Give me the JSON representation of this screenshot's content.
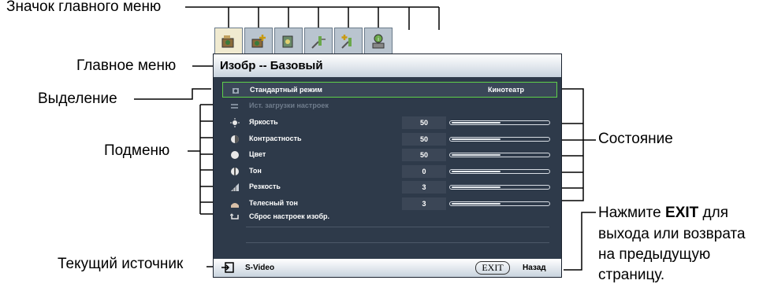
{
  "callouts": {
    "main_menu_icon": "Значок главного меню",
    "main_menu": "Главное меню",
    "highlight": "Выделение",
    "submenu": "Подменю",
    "status": "Состояние",
    "current_source": "Текущий источник",
    "exit_note_pre": "Нажмите ",
    "exit_note_key": "EXIT",
    "exit_note_post": " для",
    "exit_note_line2": "выхода или возврата",
    "exit_note_line3": "на предыдущую",
    "exit_note_line4": "страницу."
  },
  "tabs": [
    {
      "icon": "picture-icon",
      "active": true
    },
    {
      "icon": "picture-advanced-icon",
      "active": false
    },
    {
      "icon": "display-icon",
      "active": false
    },
    {
      "icon": "settings-basic-icon",
      "active": false
    },
    {
      "icon": "settings-advanced-icon",
      "active": false
    },
    {
      "icon": "information-icon",
      "active": false
    }
  ],
  "menu_title": "Изобр -- Базовый",
  "rows": [
    {
      "label": "Стандартный режим",
      "value": "Кинотеатр",
      "icon": "mode-icon",
      "selected": true
    },
    {
      "label": "Ист. загрузки настроек",
      "icon": "load-settings-icon",
      "disabled": true
    },
    {
      "label": "Яркость",
      "value": "50",
      "level": 0.5,
      "icon": "brightness-icon"
    },
    {
      "label": "Контрастность",
      "value": "50",
      "level": 0.5,
      "icon": "contrast-icon"
    },
    {
      "label": "Цвет",
      "value": "50",
      "level": 0.5,
      "icon": "color-icon"
    },
    {
      "label": "Тон",
      "value": "0",
      "level": 0.5,
      "icon": "tint-icon"
    },
    {
      "label": "Резкость",
      "value": "3",
      "level": 0.5,
      "icon": "sharpness-icon"
    },
    {
      "label": "Телесный тон",
      "value": "3",
      "level": 0.5,
      "icon": "flesh-tone-icon"
    },
    {
      "label": "Сброс настроек изобр.",
      "icon": "reset-icon"
    }
  ],
  "footer": {
    "source": "S-Video",
    "exit_button": "EXIT",
    "back": "Назад"
  },
  "colors": {
    "highlight": "#5ed04a",
    "osd_background": "#2e3a4a"
  }
}
